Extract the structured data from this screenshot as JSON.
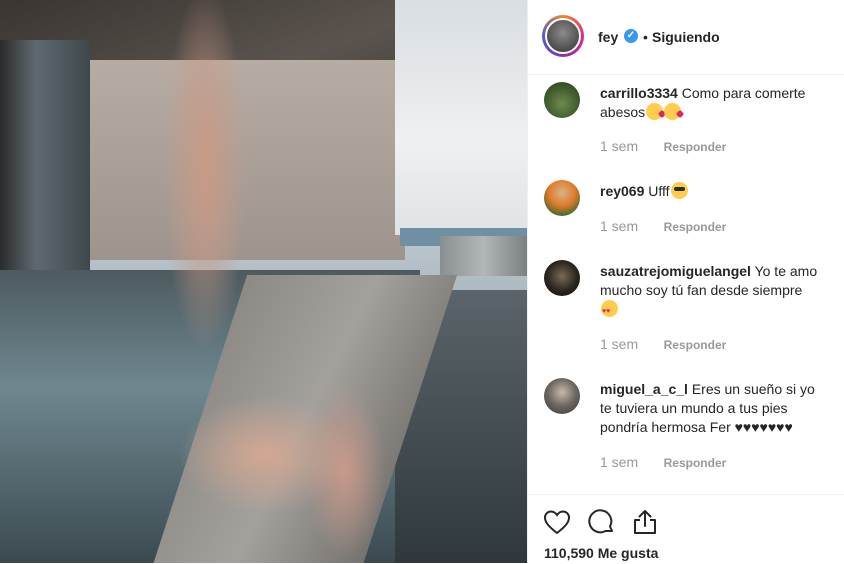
{
  "post": {
    "username": "fey",
    "separator": "•",
    "follow_status": "Siguiendo"
  },
  "comments": [
    {
      "username": "carrillo3334",
      "text": "Como para comerte abesos",
      "time": "1 sem",
      "reply_label": "Responder"
    },
    {
      "username": "rey069",
      "text": "Ufff",
      "time": "1 sem",
      "reply_label": "Responder"
    },
    {
      "username": "sauzatrejomiguelangel",
      "text": "Yo te amo mucho soy tú fan desde siempre",
      "time": "1 sem",
      "reply_label": "Responder"
    },
    {
      "username": "miguel_a_c_l",
      "text": "Eres un sueño si yo te tuviera un mundo a tus pies pondría hermosa Fer ♥♥♥♥♥♥♥",
      "time": "1 sem",
      "reply_label": "Responder"
    }
  ],
  "actions": {
    "icons": [
      "heart-icon",
      "comment-icon",
      "share-icon"
    ],
    "likes_text": "110,590 Me gusta"
  }
}
